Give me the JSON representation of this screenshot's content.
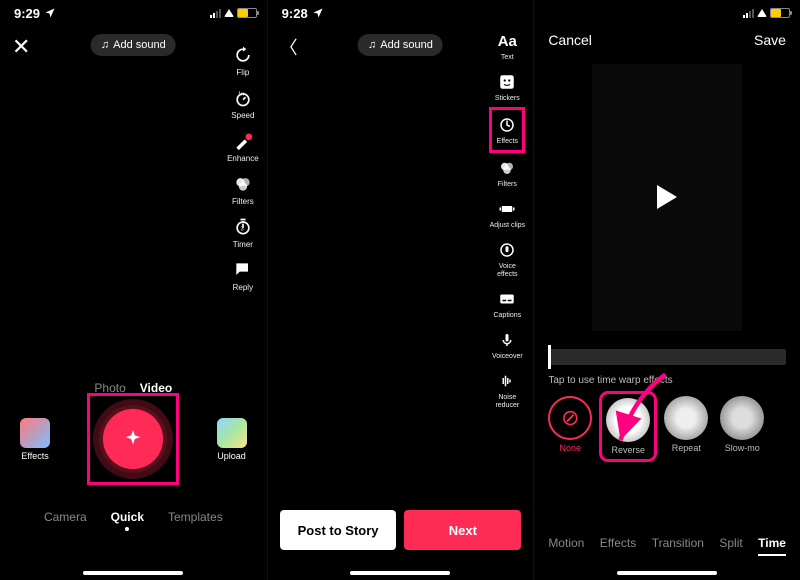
{
  "accent": "#fe2c55",
  "highlight": "#ff0080",
  "status": {
    "time1": "9:29",
    "time2": "9:28",
    "time3": ""
  },
  "phone1": {
    "add_sound": "Add sound",
    "tools": [
      {
        "name": "flip",
        "label": "Flip"
      },
      {
        "name": "speed",
        "label": "Speed"
      },
      {
        "name": "enhance",
        "label": "Enhance"
      },
      {
        "name": "filters",
        "label": "Filters"
      },
      {
        "name": "timer",
        "label": "Timer"
      },
      {
        "name": "reply",
        "label": "Reply"
      }
    ],
    "pv_tabs": {
      "photo": "Photo",
      "video": "Video"
    },
    "effects": "Effects",
    "upload": "Upload",
    "bottom_tabs": {
      "camera": "Camera",
      "quick": "Quick",
      "templates": "Templates"
    }
  },
  "phone2": {
    "add_sound": "Add sound",
    "tools": [
      {
        "name": "text",
        "label": "Text",
        "glyph": "Aa"
      },
      {
        "name": "stickers",
        "label": "Stickers"
      },
      {
        "name": "effects",
        "label": "Effects",
        "hl": true
      },
      {
        "name": "filters",
        "label": "Filters"
      },
      {
        "name": "adjust-clips",
        "label": "Adjust clips"
      },
      {
        "name": "voice-effects",
        "label": "Voice effects"
      },
      {
        "name": "captions",
        "label": "Captions"
      },
      {
        "name": "voiceover",
        "label": "Voiceover"
      },
      {
        "name": "noise-reducer",
        "label": "Noise reducer"
      }
    ],
    "post_story": "Post to Story",
    "next": "Next"
  },
  "phone3": {
    "cancel": "Cancel",
    "save": "Save",
    "hint": "Tap to use time warp effects",
    "fx": [
      {
        "name": "none",
        "label": "None"
      },
      {
        "name": "reverse",
        "label": "Reverse",
        "sel": true
      },
      {
        "name": "repeat",
        "label": "Repeat"
      },
      {
        "name": "slow-mo",
        "label": "Slow-mo"
      }
    ],
    "tabs": {
      "motion": "Motion",
      "effects": "Effects",
      "transition": "Transition",
      "split": "Split",
      "time": "Time"
    }
  }
}
